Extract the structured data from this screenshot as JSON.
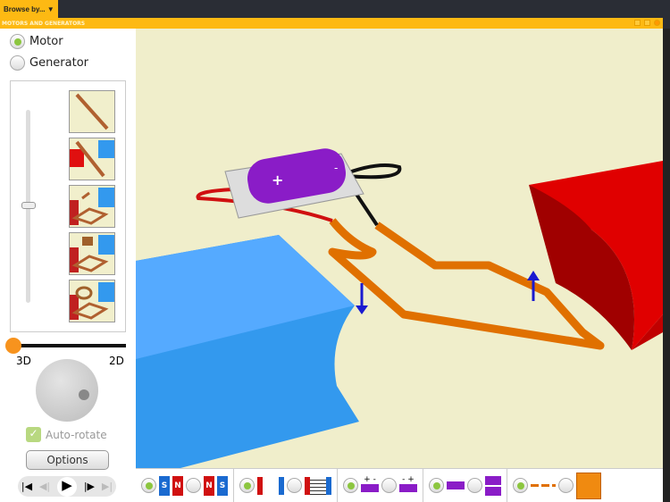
{
  "topbar": {
    "browse_label": "Browse by...",
    "browse_arrow": "▼"
  },
  "window": {
    "title": "MOTORS AND GENERATORS"
  },
  "mode": {
    "options": [
      {
        "label": "Motor",
        "selected": true
      },
      {
        "label": "Generator",
        "selected": false
      }
    ]
  },
  "view": {
    "left_label": "3D",
    "right_label": "2D",
    "value": 0
  },
  "autorotate": {
    "label": "Auto-rotate",
    "checked": true
  },
  "options_label": "Options",
  "playback": {
    "first": "|◀",
    "back": "◀|",
    "play": "▶",
    "forward": "|▶",
    "last": "▶|"
  },
  "bottom": {
    "magnet_labels": [
      "S",
      "N",
      "N",
      "S"
    ],
    "battery_signs": [
      "+",
      "-",
      "-",
      "+"
    ]
  },
  "colors": {
    "accent": "#fdb913",
    "radio": "#8cc63f",
    "wire": "#f07800",
    "red_magnet": "#e01010",
    "blue_magnet": "#3399ee"
  }
}
